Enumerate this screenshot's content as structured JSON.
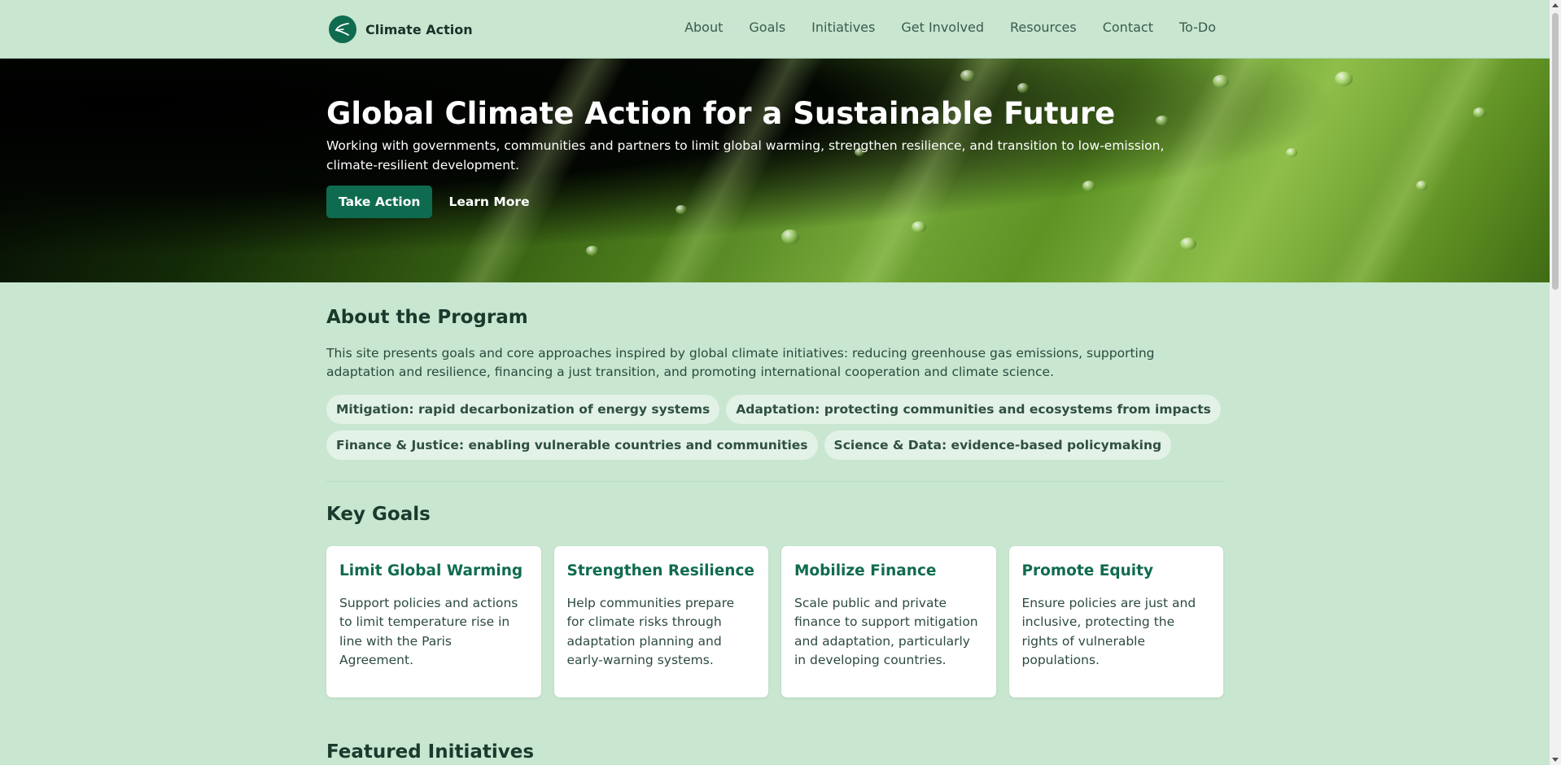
{
  "brand": {
    "name": "Climate Action",
    "logo_icon": "leaf-logo-icon"
  },
  "nav": {
    "items": [
      {
        "label": "About"
      },
      {
        "label": "Goals"
      },
      {
        "label": "Initiatives"
      },
      {
        "label": "Get Involved"
      },
      {
        "label": "Resources"
      },
      {
        "label": "Contact"
      },
      {
        "label": "To-Do"
      }
    ]
  },
  "hero": {
    "title": "Global Climate Action for a Sustainable Future",
    "subtitle": "Working with governments, communities and partners to limit global warming, strengthen resilience, and transition to low-emission, climate-resilient development.",
    "primary_button": "Take Action",
    "secondary_button": "Learn More"
  },
  "about": {
    "title": "About the Program",
    "text": "This site presents goals and core approaches inspired by global climate initiatives: reducing greenhouse gas emissions, supporting adaptation and resilience, financing a just transition, and promoting international cooperation and climate science.",
    "chips": [
      "Mitigation: rapid decarbonization of energy systems",
      "Adaptation: protecting communities and ecosystems from impacts",
      "Finance & Justice: enabling vulnerable countries and communities",
      "Science & Data: evidence-based policymaking"
    ]
  },
  "goals": {
    "title": "Key Goals",
    "cards": [
      {
        "title": "Limit Global Warming",
        "text": "Support policies and actions to limit temperature rise in line with the Paris Agreement."
      },
      {
        "title": "Strengthen Resilience",
        "text": "Help communities prepare for climate risks through adaptation planning and early-warning systems."
      },
      {
        "title": "Mobilize Finance",
        "text": "Scale public and private finance to support mitigation and adaptation, particularly in developing countries."
      },
      {
        "title": "Promote Equity",
        "text": "Ensure policies are just and inclusive, protecting the rights of vulnerable populations."
      }
    ]
  },
  "featured": {
    "title": "Featured Initiatives"
  },
  "colors": {
    "accent": "#0f6b4f",
    "background": "#c8e6d0",
    "chip": "#e2f2e6"
  }
}
